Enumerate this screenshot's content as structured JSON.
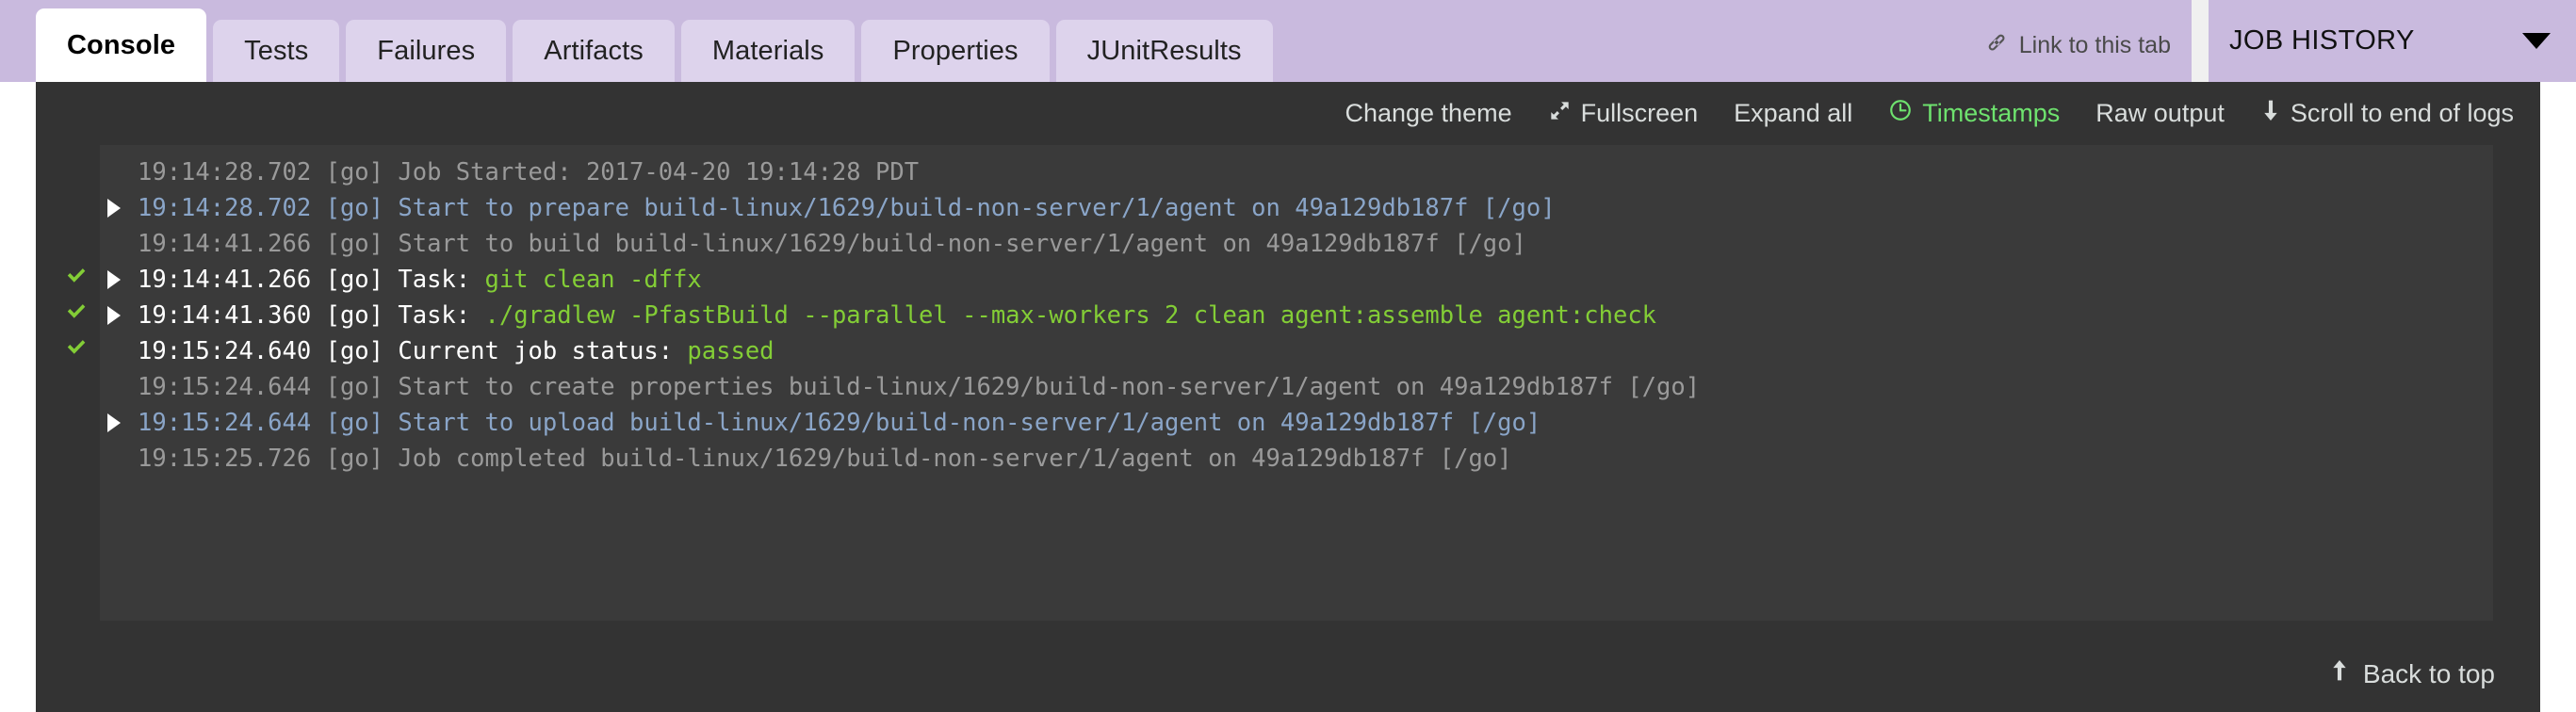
{
  "tabs": [
    {
      "label": "Console",
      "active": true
    },
    {
      "label": "Tests",
      "active": false
    },
    {
      "label": "Failures",
      "active": false
    },
    {
      "label": "Artifacts",
      "active": false
    },
    {
      "label": "Materials",
      "active": false
    },
    {
      "label": "Properties",
      "active": false
    },
    {
      "label": "JUnitResults",
      "active": false
    }
  ],
  "link_to_tab": {
    "label": "Link to this tab",
    "icon": "link-icon"
  },
  "job_history": {
    "label": "JOB HISTORY",
    "icon": "chevron-down-icon"
  },
  "toolbar": {
    "change_theme": "Change theme",
    "fullscreen": "Fullscreen",
    "expand_all": "Expand all",
    "timestamps": "Timestamps",
    "raw_output": "Raw output",
    "scroll_to_end": "Scroll to end of logs",
    "timestamps_active_color": "#6ee26e"
  },
  "back_to_top": "Back to top",
  "console": {
    "background": "#333333",
    "panel_background": "#3a3a3a",
    "colors": {
      "info": "#9a9a9a",
      "stage": "#8aa5c8",
      "task": "#ffffff",
      "highlight": "#83cd36"
    },
    "lines": [
      {
        "time": "19:14:28.702",
        "tag": "[go]",
        "text": " Job Started: 2017-04-20 19:14:28 PDT",
        "level": "info",
        "ok": false,
        "expandable": false
      },
      {
        "time": "19:14:28.702",
        "tag": "[go]",
        "text": " Start to prepare build-linux/1629/build-non-server/1/agent on 49a129db187f [/go]",
        "level": "stage",
        "ok": false,
        "expandable": true
      },
      {
        "time": "19:14:41.266",
        "tag": "[go]",
        "text": " Start to build build-linux/1629/build-non-server/1/agent on 49a129db187f [/go]",
        "level": "info",
        "ok": false,
        "expandable": false
      },
      {
        "time": "19:14:41.266",
        "tag": "[go]",
        "text": " Task: ",
        "highlight": "git clean -dffx",
        "level": "task",
        "ok": true,
        "expandable": true
      },
      {
        "time": "19:14:41.360",
        "tag": "[go]",
        "text": " Task: ",
        "highlight": "./gradlew -PfastBuild --parallel --max-workers 2 clean agent:assemble agent:check",
        "level": "task",
        "ok": true,
        "expandable": true
      },
      {
        "time": "19:15:24.640",
        "tag": "[go]",
        "text": " Current job status: ",
        "highlight": "passed",
        "level": "task",
        "ok": true,
        "expandable": false
      },
      {
        "time": "19:15:24.644",
        "tag": "[go]",
        "text": " Start to create properties build-linux/1629/build-non-server/1/agent on 49a129db187f [/go]",
        "level": "info",
        "ok": false,
        "expandable": false
      },
      {
        "time": "19:15:24.644",
        "tag": "[go]",
        "text": " Start to upload build-linux/1629/build-non-server/1/agent on 49a129db187f [/go]",
        "level": "stage",
        "ok": false,
        "expandable": true
      },
      {
        "time": "19:15:25.726",
        "tag": "[go]",
        "text": " Job completed build-linux/1629/build-non-server/1/agent on 49a129db187f [/go]",
        "level": "info",
        "ok": false,
        "expandable": false
      }
    ]
  }
}
